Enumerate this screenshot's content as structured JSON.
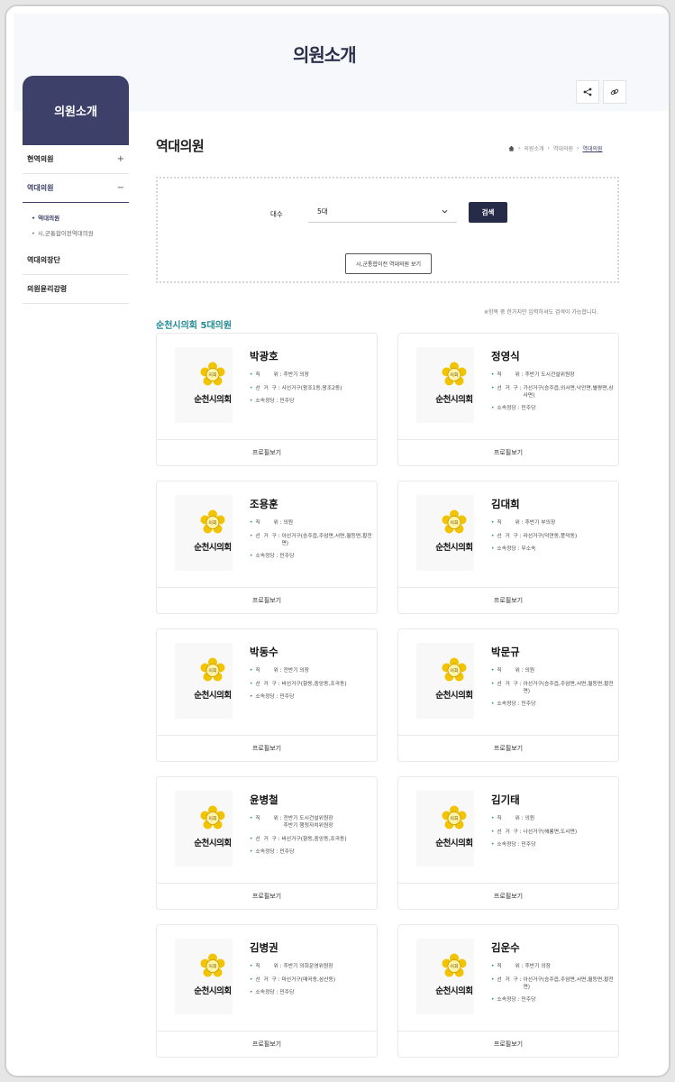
{
  "banner": {
    "title": "의원소개"
  },
  "sidebar": {
    "title": "의원소개",
    "items": [
      {
        "label": "현역의원",
        "sign": "+"
      },
      {
        "label": "역대의원",
        "sign": "−"
      },
      {
        "label": "역대의장단"
      },
      {
        "label": "의원윤리강령"
      }
    ],
    "sub_items": [
      {
        "label": "역대의원"
      },
      {
        "label": "시,군통합이전역대의원"
      }
    ]
  },
  "page": {
    "title": "역대의원",
    "breadcrumb": [
      "의원소개",
      "역대의원",
      "역대의원"
    ]
  },
  "search": {
    "label": "대수",
    "selected": "5대",
    "button": "검색",
    "prev_button": "시,군통합이전 역대의원 보기",
    "hint": "※항목 중 한가지만 입력하셔도 검색이 가능합니다."
  },
  "section": {
    "title": "순천시의회 5대의원"
  },
  "logo_text": "순천시의회",
  "logo_seal_text": "의회",
  "labels": {
    "position": "직        위 : ",
    "district": "선  거  구 : ",
    "party": "소속정당 : ",
    "profile": "프로필보기"
  },
  "members": [
    {
      "name": "박광호",
      "position": "후반기 의장",
      "district": "사선거구(왕조1동,왕조2동)",
      "party": "민주당"
    },
    {
      "name": "정영식",
      "position": "후반기 도시건설위원장",
      "district": "가선거구(승주읍,외서면,낙안면,별량면,상사면)",
      "party": "민주당"
    },
    {
      "name": "조용훈",
      "position": "의원",
      "district": "아선거구(승주읍,주암면,서면,월등면,황전면)",
      "party": "민주당"
    },
    {
      "name": "김대희",
      "position": "후반기 부의장",
      "district": "라선거구(덕연동,풍덕동)",
      "party": "무소속"
    },
    {
      "name": "박동수",
      "position": "전반기 의장",
      "district": "바선거구(향동,중앙동,조곡동)",
      "party": "민주당"
    },
    {
      "name": "박문규",
      "position": "의원",
      "district": "아선거구(승주읍,주암면,서면,월등면,황전면)",
      "party": "민주당"
    },
    {
      "name": "윤병철",
      "position": "전반기 도시건설위원장\n후반기 행정자치위원장",
      "district": "바선거구(향동,중앙동,조곡동)",
      "party": "민주당"
    },
    {
      "name": "김기태",
      "position": "의원",
      "district": "나선거구(해룡면,도사면)",
      "party": "민주당"
    },
    {
      "name": "김병권",
      "position": "후반기 의회운영위원장",
      "district": "마선거구(매곡동,삼산동)",
      "party": "민주당"
    },
    {
      "name": "김운수",
      "position": "후반기 의장",
      "district": "아선거구(승주읍,주암면,서면,월등면,황전면)",
      "party": "민주당"
    }
  ]
}
